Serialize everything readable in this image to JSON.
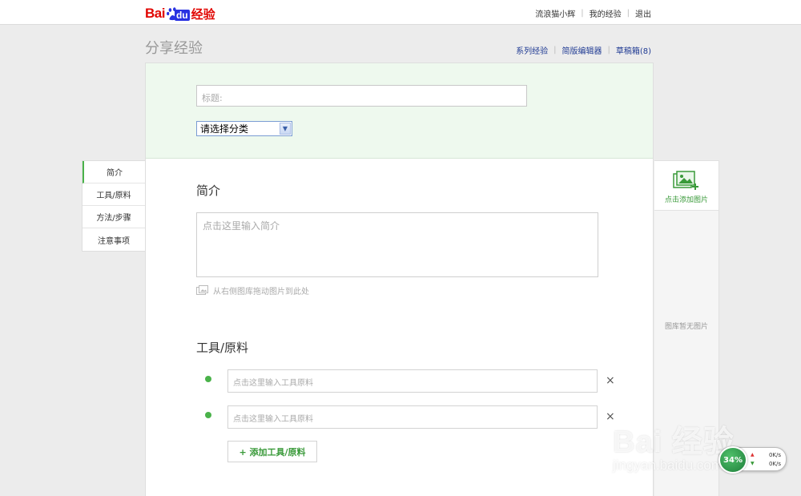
{
  "brand": {
    "logo_bai": "Bai",
    "logo_du": "du",
    "logo_jy": "经验",
    "red": "#e10602",
    "blue": "#2932e1"
  },
  "top_links": {
    "user": "流浪猫小辉",
    "my_exp": "我的经验",
    "logout": "退出"
  },
  "page_title": "分享经验",
  "sub_nav": {
    "series": "系列经验",
    "simple_editor": "简版编辑器",
    "drafts": "草稿箱(8)"
  },
  "form": {
    "title_placeholder": "标题:",
    "category_selected": "请选择分类"
  },
  "left_nav": [
    "简介",
    "工具/原料",
    "方法/步骤",
    "注意事项"
  ],
  "intro": {
    "heading": "简介",
    "placeholder": "点击这里输入简介",
    "drag_hint": "从右侧图库拖动图片到此处"
  },
  "tools": {
    "heading": "工具/原料",
    "item_placeholder_1": "点击这里输入工具原料",
    "item_placeholder_2": "点击这里输入工具原料",
    "delete_symbol": "×",
    "add_label": "+ 添加工具/原料"
  },
  "image_panel": {
    "add_label": "点击添加图片",
    "empty_label": "图库暂无图片"
  },
  "watermark": {
    "big": "Bai 经验",
    "small": "jingyan.baidu.com"
  },
  "speed_widget": {
    "percent": "34%",
    "up": "0K/s",
    "down": "0K/s"
  },
  "colors": {
    "accent_green": "#4ab24a",
    "link_blue": "#1f3a93",
    "header_green_bg": "#eef9ee"
  }
}
